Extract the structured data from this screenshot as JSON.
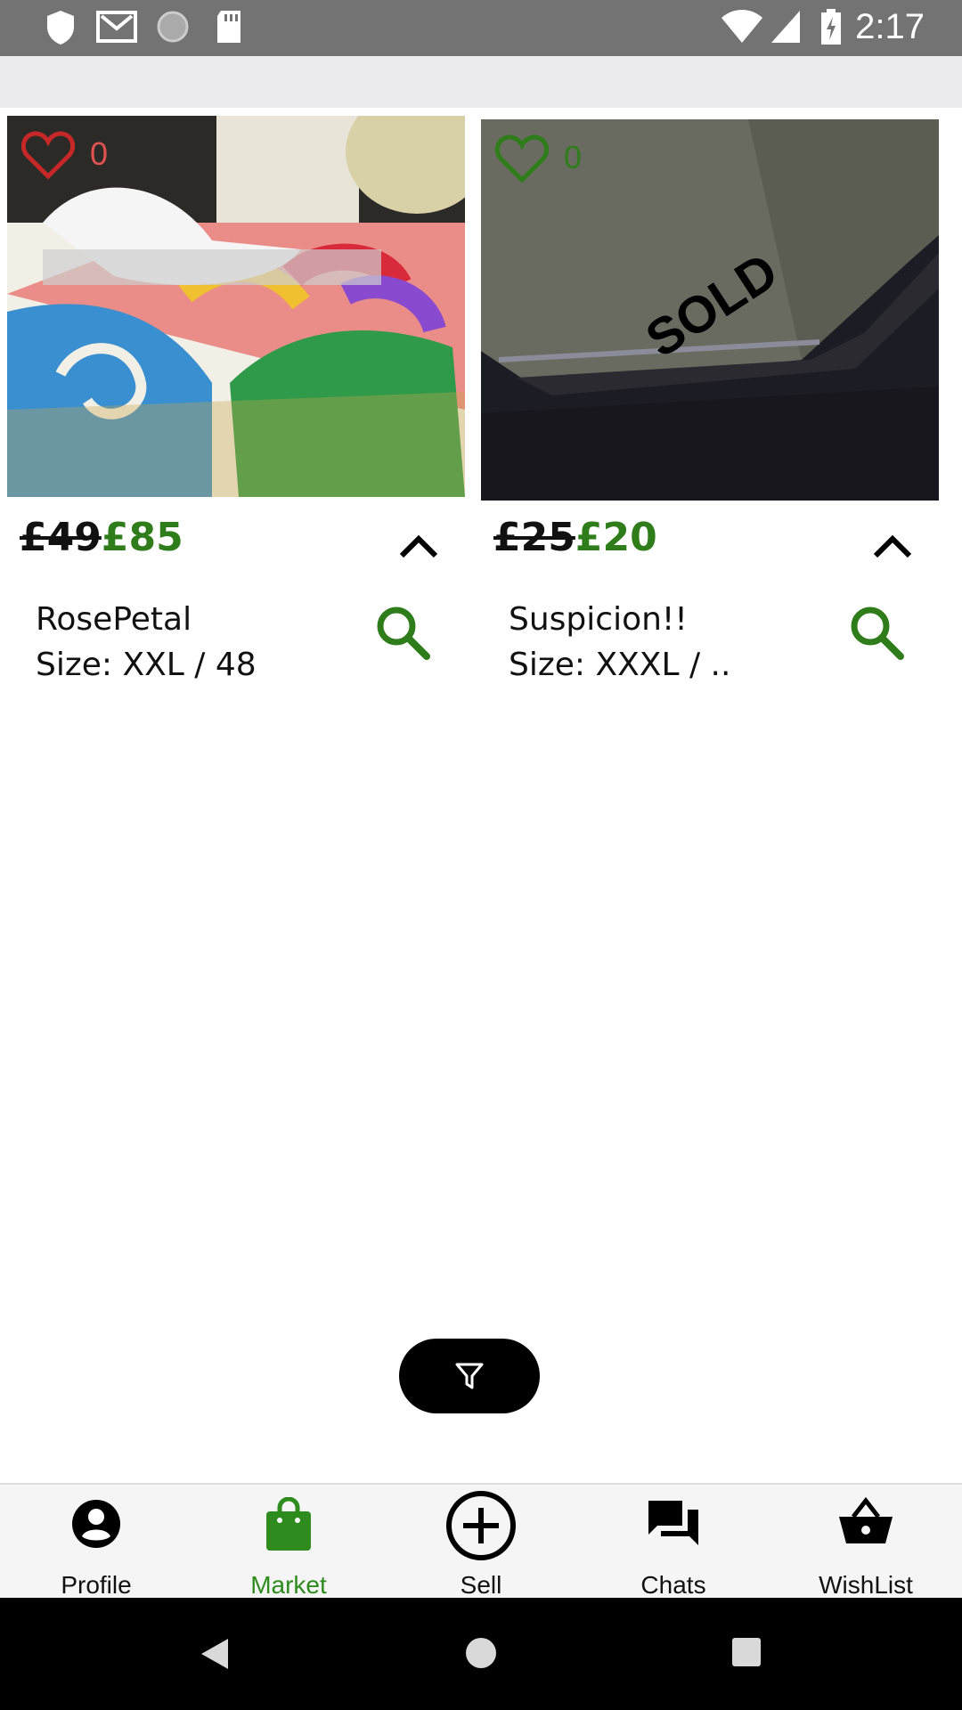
{
  "status_bar": {
    "time": "2:17"
  },
  "listings": [
    {
      "likes": "0",
      "old_price": "£49",
      "new_price": "£85",
      "name": "RosePetal",
      "size": "Size: XXL / 48",
      "image": "tissue-box-photo"
    },
    {
      "likes": "0",
      "old_price": "£25",
      "new_price": "£20",
      "name": "Suspicion!!",
      "size": "Size: XXXL / ..",
      "image": "dark-photo-sold",
      "sold_label": "SOLD"
    }
  ],
  "tabs": [
    {
      "label": "Profile",
      "icon": "profile-icon"
    },
    {
      "label": "Market",
      "icon": "shopping-bag-icon",
      "active": true
    },
    {
      "label": "Sell",
      "icon": "add-circle-icon"
    },
    {
      "label": "Chats",
      "icon": "chat-icon"
    },
    {
      "label": "WishList",
      "icon": "basket-icon"
    }
  ],
  "colors": {
    "accent": "#2e7d1a",
    "like_red": "#c62828",
    "status_bar": "#737373"
  }
}
